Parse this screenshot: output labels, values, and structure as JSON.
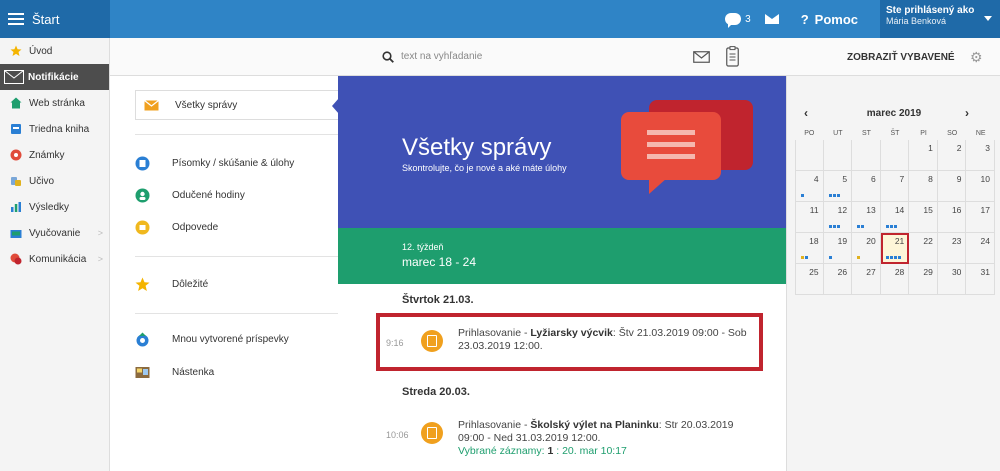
{
  "topbar": {
    "app_title": "Štart",
    "chat_count": "3",
    "help_label": "Pomoc",
    "user_line1": "Ste prihlásený ako",
    "user_line2": "Mária Benková"
  },
  "sidebar": {
    "items": [
      {
        "label": "Úvod",
        "icon": "star-icon"
      },
      {
        "label": "Notifikácie",
        "icon": "envelope-icon"
      },
      {
        "label": "Web stránka",
        "icon": "home-icon"
      },
      {
        "label": "Triedna kniha",
        "icon": "book-icon"
      },
      {
        "label": "Známky",
        "icon": "grades-icon"
      },
      {
        "label": "Učivo",
        "icon": "hat-icon"
      },
      {
        "label": "Výsledky",
        "icon": "bar-chart-icon"
      },
      {
        "label": "Vyučovanie",
        "icon": "school-icon"
      },
      {
        "label": "Komunikácia",
        "icon": "chat-icon"
      }
    ]
  },
  "search": {
    "placeholder": "text na vyhľadanie",
    "show_label": "ZOBRAZIŤ VYBAVENÉ"
  },
  "folders": {
    "all": "Všetky správy",
    "tests": "Písomky / skúšanie & úlohy",
    "lessons": "Odučené hodiny",
    "answers": "Odpovede",
    "important": "Dôležité",
    "created": "Mnou vytvorené príspevky",
    "board": "Nástenka"
  },
  "hero": {
    "title": "Všetky správy",
    "subtitle": "Skontrolujte, čo je nové a aké máte úlohy",
    "accent": "#3f51b5"
  },
  "week": {
    "label": "12. týždeň",
    "range": "marec 18 - 24"
  },
  "messages": {
    "day1": "Štvrtok 21.03.",
    "m1": {
      "time": "9:16",
      "prefix": "Prihlasovanie - ",
      "bold": "Lyžiarsky výcvik",
      "rest": ": Štv 21.03.2019 09:00 - Sob 23.03.2019 12:00."
    },
    "day2": "Streda 20.03.",
    "m2": {
      "time": "10:06",
      "prefix": "Prihlasovanie - ",
      "bold": "Školský výlet na Planinku",
      "rest": ": Str 20.03.2019 09:00 - Ned 31.03.2019 12:00.",
      "selected_label": "Vybrané záznamy: ",
      "selected_count": "1",
      "selected_rest": " : 20. mar 10:17"
    }
  },
  "calendar": {
    "prev": "‹",
    "next": "›",
    "month": "marec 2019",
    "dow": [
      "PO",
      "UT",
      "ST",
      "ŠT",
      "PI",
      "SO",
      "NE"
    ],
    "weeks": [
      [
        "",
        "",
        "",
        "",
        "1",
        "2",
        "3"
      ],
      [
        "4",
        "5",
        "6",
        "7",
        "8",
        "9",
        "10"
      ],
      [
        "11",
        "12",
        "13",
        "14",
        "15",
        "16",
        "17"
      ],
      [
        "18",
        "19",
        "20",
        "21",
        "22",
        "23",
        "24"
      ],
      [
        "25",
        "26",
        "27",
        "28",
        "29",
        "30",
        "31"
      ]
    ],
    "today": "21"
  }
}
